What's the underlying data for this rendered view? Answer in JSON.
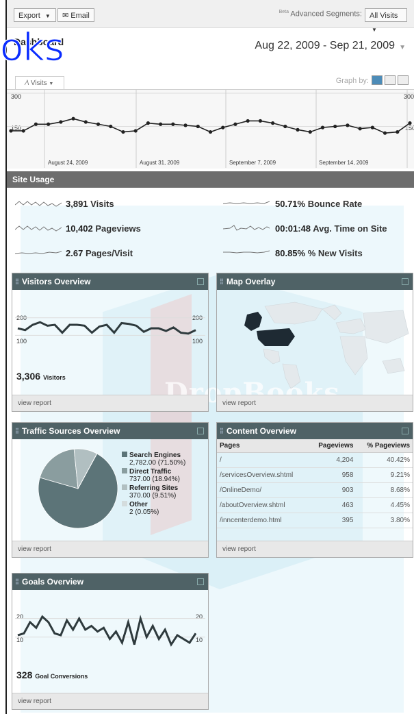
{
  "toolbar": {
    "export_label": "Export",
    "email_label": "Email",
    "beta_label": "Beta",
    "advanced_segments_label": "Advanced Segments:",
    "segment_value": "All Visits"
  },
  "page": {
    "title": "Dashboard",
    "date_range": "Aug 22, 2009 - Sep 21, 2009"
  },
  "graph_controls": {
    "graph_by_label": "Graph by:",
    "visits_tab_label": "Visits"
  },
  "watermark": {
    "logo_text": "oks",
    "brand_text": "DropBooks"
  },
  "main_chart": {
    "y_ticks_left": [
      "300",
      "150"
    ],
    "y_ticks_right": [
      "300",
      "150"
    ],
    "x_labels": [
      "August 24, 2009",
      "August 31, 2009",
      "September 7, 2009",
      "September 14, 2009"
    ]
  },
  "chart_data": [
    {
      "type": "line",
      "series": [
        {
          "values": [
            130,
            130,
            160,
            160,
            170,
            185,
            170,
            160,
            150,
            125,
            130,
            165,
            160,
            160,
            155,
            150,
            125,
            145,
            160,
            175,
            175,
            165,
            150,
            135,
            125,
            145,
            150,
            155,
            140,
            145,
            120,
            125,
            165
          ]
        }
      ],
      "ylim": [
        0,
        300
      ]
    },
    {
      "type": "line",
      "series": [
        {
          "values": [
            140,
            130,
            160,
            175,
            155,
            160,
            115,
            160,
            160,
            155,
            115,
            150,
            160,
            115,
            170,
            165,
            155,
            120,
            140,
            140,
            125,
            145,
            115,
            110,
            130
          ]
        }
      ],
      "ylim": [
        0,
        250
      ]
    },
    {
      "type": "pie",
      "categories": [
        "Search Engines",
        "Direct Traffic",
        "Referring Sites",
        "Other"
      ],
      "values": [
        71.5,
        18.94,
        9.51,
        0.05
      ]
    },
    {
      "type": "line",
      "series": [
        {
          "values": [
            11,
            12,
            18,
            15,
            21,
            18,
            12,
            11,
            19,
            14,
            20,
            14,
            16,
            13,
            15,
            9,
            13,
            7,
            18,
            6,
            20,
            10,
            16,
            9,
            14,
            6,
            11,
            9,
            7,
            12
          ]
        }
      ],
      "ylim": [
        0,
        25
      ]
    }
  ],
  "site_usage": {
    "title": "Site Usage",
    "metrics": [
      {
        "value": "3,891",
        "label": "Visits"
      },
      {
        "value": "10,402",
        "label": "Pageviews"
      },
      {
        "value": "2.67",
        "label": "Pages/Visit"
      },
      {
        "value": "50.71%",
        "label": "Bounce Rate"
      },
      {
        "value": "00:01:48",
        "label": "Avg. Time on Site"
      },
      {
        "value": "80.85%",
        "label": "% New Visits"
      }
    ]
  },
  "visitors_overview": {
    "title": "Visitors Overview",
    "y_top": "200",
    "y_bottom": "100",
    "total": "3,306",
    "total_label": "Visitors",
    "link": "view report"
  },
  "map_overlay": {
    "title": "Map Overlay",
    "link": "view report"
  },
  "traffic_sources": {
    "title": "Traffic Sources Overview",
    "legend": [
      {
        "name": "Search Engines",
        "detail": "2,782.00 (71.50%)",
        "color": "#5c7478"
      },
      {
        "name": "Direct Traffic",
        "detail": "737.00 (18.94%)",
        "color": "#8a9d9f"
      },
      {
        "name": "Referring Sites",
        "detail": "370.00 (9.51%)",
        "color": "#b1bfc1"
      },
      {
        "name": "Other",
        "detail": "2 (0.05%)",
        "color": "#d4dcdd"
      }
    ],
    "link": "view report"
  },
  "content_overview": {
    "title": "Content Overview",
    "columns": [
      "Pages",
      "Pageviews",
      "% Pageviews"
    ],
    "rows": [
      [
        "/",
        "4,204",
        "40.42%"
      ],
      [
        "/servicesOverview.shtml",
        "958",
        "9.21%"
      ],
      [
        "/OnlineDemo/",
        "903",
        "8.68%"
      ],
      [
        "/aboutOverview.shtml",
        "463",
        "4.45%"
      ],
      [
        "/inncenterdemo.html",
        "395",
        "3.80%"
      ]
    ],
    "link": "view report"
  },
  "goals_overview": {
    "title": "Goals Overview",
    "y_top": "20",
    "y_bottom": "10",
    "total": "328",
    "total_label": "Goal Conversions",
    "link": "view report"
  }
}
